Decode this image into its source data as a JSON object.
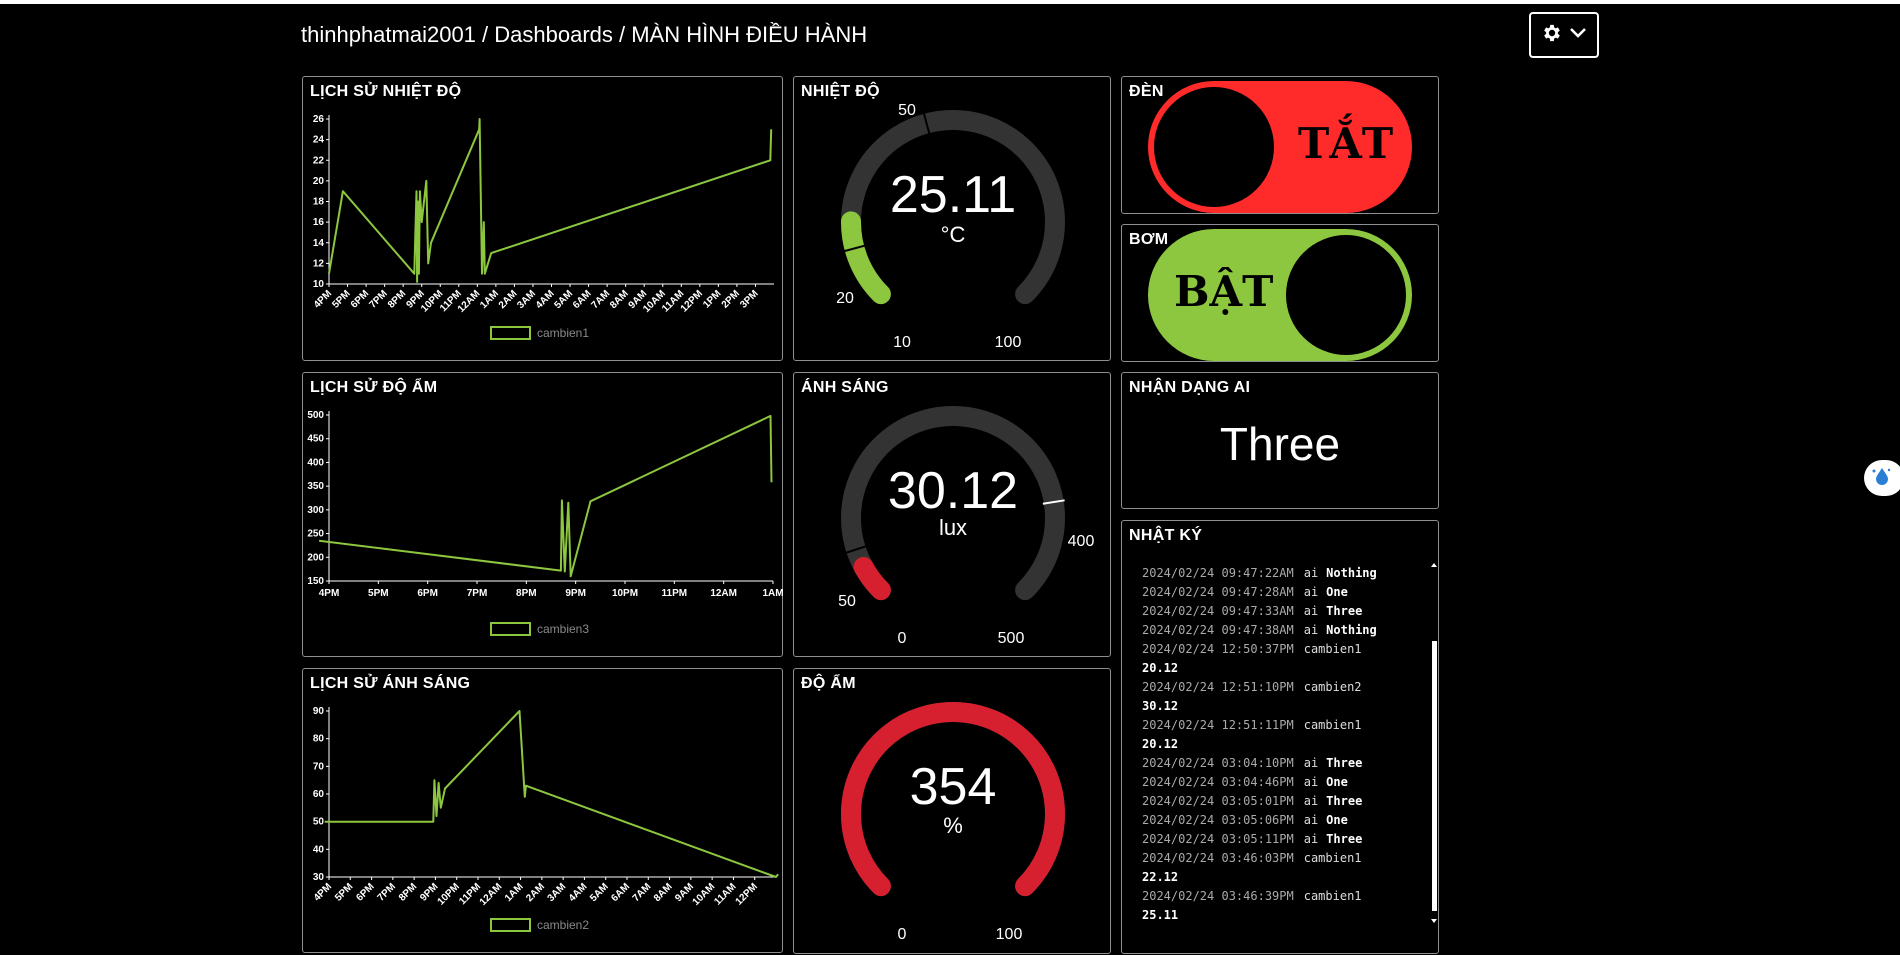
{
  "breadcrumb": "thinhphatmai2001 / Dashboards / MÀN HÌNH ĐIỀU HÀNH",
  "panels": {
    "temp_history": {
      "title": "LỊCH SỬ NHIỆT ĐỘ"
    },
    "humid_history": {
      "title": "LỊCH SỬ ĐỘ ẨM"
    },
    "light_history": {
      "title": "LỊCH SỬ ÁNH SÁNG"
    },
    "temp_gauge": {
      "title": "NHIỆT ĐỘ",
      "value": "25.11",
      "unit": "°C",
      "min": "10",
      "max": "100",
      "low_mark": "20",
      "high_mark": "50",
      "value_num": 25.11,
      "min_num": 10,
      "max_num": 100,
      "low_num": 20,
      "high_num": 50,
      "color": "#8dc63f"
    },
    "light_gauge": {
      "title": "ÁNH SÁNG",
      "value": "30.12",
      "unit": "lux",
      "min": "0",
      "max": "500",
      "low_mark": "50",
      "high_mark": "400",
      "value_num": 30.12,
      "min_num": 0,
      "max_num": 500,
      "low_num": 50,
      "high_num": 400,
      "color": "#d6202f"
    },
    "humid_gauge": {
      "title": "ĐỘ ẨM",
      "value": "354",
      "unit": "%",
      "min": "0",
      "max": "100",
      "value_num": 354,
      "min_num": 0,
      "max_num": 100,
      "color": "#d6202f"
    },
    "light_toggle": {
      "title": "ĐÈN",
      "state_label": "TẮT",
      "state": "off",
      "color": "#ff2a2a"
    },
    "pump_toggle": {
      "title": "BƠM",
      "state_label": "BẬT",
      "state": "on",
      "color": "#8dc63f"
    },
    "ai": {
      "title": "NHẬN DẠNG AI",
      "value": "Three"
    },
    "log": {
      "title": "NHẬT KÝ",
      "entries": [
        {
          "ts": "2024/02/24 09:47:22AM",
          "feed": "ai",
          "value": "Nothing",
          "wrap": false
        },
        {
          "ts": "2024/02/24 09:47:28AM",
          "feed": "ai",
          "value": "One",
          "wrap": false
        },
        {
          "ts": "2024/02/24 09:47:33AM",
          "feed": "ai",
          "value": "Three",
          "wrap": false
        },
        {
          "ts": "2024/02/24 09:47:38AM",
          "feed": "ai",
          "value": "Nothing",
          "wrap": false
        },
        {
          "ts": "2024/02/24 12:50:37PM",
          "feed": "cambien1",
          "value": "20.12",
          "wrap": true
        },
        {
          "ts": "2024/02/24 12:51:10PM",
          "feed": "cambien2",
          "value": "30.12",
          "wrap": true
        },
        {
          "ts": "2024/02/24 12:51:11PM",
          "feed": "cambien1",
          "value": "20.12",
          "wrap": true
        },
        {
          "ts": "2024/02/24 03:04:10PM",
          "feed": "ai",
          "value": "Three",
          "wrap": false
        },
        {
          "ts": "2024/02/24 03:04:46PM",
          "feed": "ai",
          "value": "One",
          "wrap": false
        },
        {
          "ts": "2024/02/24 03:05:01PM",
          "feed": "ai",
          "value": "Three",
          "wrap": false
        },
        {
          "ts": "2024/02/24 03:05:06PM",
          "feed": "ai",
          "value": "One",
          "wrap": false
        },
        {
          "ts": "2024/02/24 03:05:11PM",
          "feed": "ai",
          "value": "Three",
          "wrap": false
        },
        {
          "ts": "2024/02/24 03:46:03PM",
          "feed": "cambien1",
          "value": "22.12",
          "wrap": true
        },
        {
          "ts": "2024/02/24 03:46:39PM",
          "feed": "cambien1",
          "value": "25.11",
          "wrap": true
        }
      ]
    }
  },
  "icons": {
    "settings": "gear-icon",
    "dropdown": "chevron-down-icon",
    "side_widget": "water-drop-icon"
  },
  "chart_data": [
    {
      "type": "line",
      "legend": "cambien1",
      "color": "#8dc63f",
      "yticks": [
        10,
        12,
        14,
        16,
        18,
        20,
        22,
        24,
        26
      ],
      "ylim": [
        10,
        26
      ],
      "xticks": [
        "4PM",
        "5PM",
        "6PM",
        "7PM",
        "8PM",
        "9PM",
        "10PM",
        "11PM",
        "12AM",
        "1AM",
        "2AM",
        "3AM",
        "4AM",
        "5AM",
        "6AM",
        "7AM",
        "8AM",
        "9AM",
        "10AM",
        "11AM",
        "12PM",
        "1PM",
        "2PM",
        "3PM"
      ],
      "xlim": [
        0,
        24
      ],
      "x": [
        0,
        0.75,
        4.6,
        4.72,
        4.75,
        4.8,
        4.85,
        4.9,
        5.0,
        5.25,
        5.35,
        5.5,
        8.1,
        8.12,
        8.25,
        8.35,
        8.4,
        8.75,
        23.8,
        23.85
      ],
      "y": [
        11,
        19,
        11,
        19,
        10.2,
        18,
        11,
        19,
        16,
        20,
        12,
        14,
        25,
        26,
        11,
        16,
        11,
        13,
        22,
        25
      ]
    },
    {
      "type": "line",
      "legend": "cambien3",
      "color": "#8dc63f",
      "yticks": [
        150,
        200,
        250,
        300,
        350,
        400,
        450,
        500
      ],
      "ylim": [
        150,
        500
      ],
      "xticks": [
        "4PM",
        "5PM",
        "6PM",
        "7PM",
        "8PM",
        "9PM",
        "10PM",
        "11PM",
        "12AM",
        "1AM"
      ],
      "xlim": [
        0,
        9
      ],
      "x": [
        -0.2,
        4.7,
        4.72,
        4.78,
        4.85,
        4.9,
        5.3,
        8.95,
        8.97
      ],
      "y": [
        235,
        172,
        320,
        170,
        315,
        160,
        318,
        498,
        358
      ]
    },
    {
      "type": "line",
      "legend": "cambien2",
      "color": "#8dc63f",
      "yticks": [
        30,
        40,
        50,
        60,
        70,
        80,
        90
      ],
      "ylim": [
        30,
        90
      ],
      "xticks": [
        "4PM",
        "5PM",
        "6PM",
        "7PM",
        "8PM",
        "9PM",
        "10PM",
        "11PM",
        "12AM",
        "1AM",
        "2AM",
        "3AM",
        "4AM",
        "5AM",
        "6AM",
        "7AM",
        "8AM",
        "9AM",
        "10AM",
        "11AM",
        "12PM"
      ],
      "xlim": [
        0,
        21
      ],
      "x": [
        -0.2,
        4.9,
        4.95,
        5.05,
        5.15,
        5.25,
        5.45,
        8.95,
        9.2,
        9.25,
        21.0,
        21.1
      ],
      "y": [
        50,
        50,
        65,
        52,
        64,
        55,
        62,
        90,
        59,
        63,
        30,
        31
      ]
    }
  ]
}
